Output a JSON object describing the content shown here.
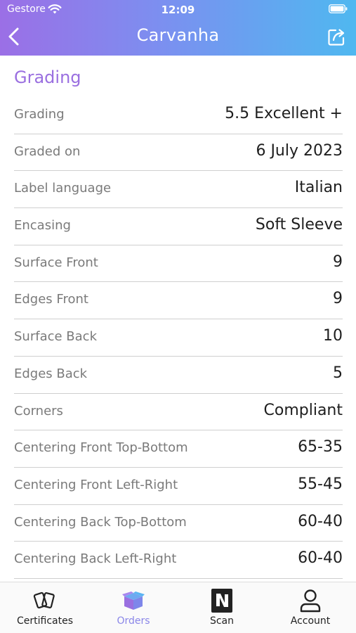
{
  "status_bar": {
    "carrier": "Gestore",
    "time": "12:09"
  },
  "nav": {
    "title": "Carvanha"
  },
  "section": {
    "title": "Grading"
  },
  "rows": [
    {
      "label": "Grading",
      "value": "5.5 Excellent +"
    },
    {
      "label": "Graded on",
      "value": "6 July 2023"
    },
    {
      "label": "Label language",
      "value": "Italian"
    },
    {
      "label": "Encasing",
      "value": "Soft Sleeve"
    },
    {
      "label": "Surface Front",
      "value": "9"
    },
    {
      "label": "Edges Front",
      "value": "9"
    },
    {
      "label": "Surface Back",
      "value": "10"
    },
    {
      "label": "Edges Back",
      "value": "5"
    },
    {
      "label": "Corners",
      "value": "Compliant"
    },
    {
      "label": "Centering Front Top-Bottom",
      "value": "65-35"
    },
    {
      "label": "Centering Front Left-Right",
      "value": "55-45"
    },
    {
      "label": "Centering Back Top-Bottom",
      "value": "60-40"
    },
    {
      "label": "Centering Back Left-Right",
      "value": "60-40"
    }
  ],
  "tabs": [
    {
      "label": "Certificates",
      "icon": "cards-icon",
      "active": false
    },
    {
      "label": "Orders",
      "icon": "box-icon",
      "active": true
    },
    {
      "label": "Scan",
      "icon": "nfc-icon",
      "active": false
    },
    {
      "label": "Account",
      "icon": "person-icon",
      "active": false
    }
  ],
  "colors": {
    "header_gradient_start": "#9b6fe6",
    "header_gradient_end": "#4fb8f0",
    "section_title": "#9a6fe0",
    "active_tab": "#8a86e8"
  }
}
